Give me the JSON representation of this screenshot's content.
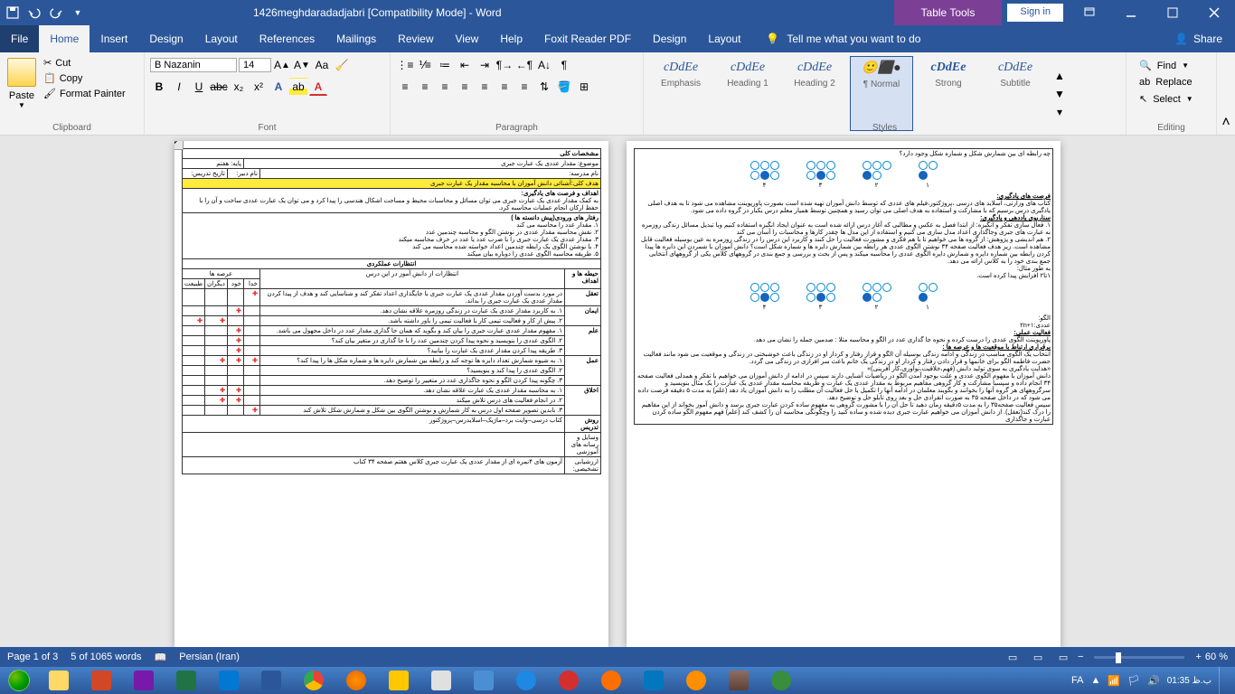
{
  "titlebar": {
    "title": "1426meghdaradadjabri [Compatibility Mode]  -  Word",
    "table_tools": "Table Tools",
    "signin": "Sign in"
  },
  "menu": {
    "file": "File",
    "home": "Home",
    "insert": "Insert",
    "design": "Design",
    "layout": "Layout",
    "references": "References",
    "mailings": "Mailings",
    "review": "Review",
    "view": "View",
    "help": "Help",
    "foxit": "Foxit Reader PDF",
    "tt_design": "Design",
    "tt_layout": "Layout",
    "tellme": "Tell me what you want to do",
    "share": "Share"
  },
  "ribbon": {
    "paste": "Paste",
    "cut": "Cut",
    "copy": "Copy",
    "format_painter": "Format Painter",
    "clipboard": "Clipboard",
    "font_name": "B Nazanin",
    "font_size": "14",
    "font": "Font",
    "paragraph": "Paragraph",
    "styles_label": "Styles",
    "styles": {
      "emphasis": "Emphasis",
      "heading1": "Heading 1",
      "heading2": "Heading 2",
      "normal": "¶ Normal",
      "strong": "Strong",
      "subtitle": "Subtitle",
      "preview": "cDdEe"
    },
    "find": "Find",
    "replace": "Replace",
    "select": "Select",
    "editing": "Editing"
  },
  "statusbar": {
    "page": "Page 1 of 3",
    "words": "5 of 1065 words",
    "language": "Persian (Iran)",
    "zoom": "60 %"
  },
  "taskbar": {
    "lang": "FA",
    "time": "ب.ظ 01:35"
  },
  "doc": {
    "p1": {
      "spec_title": "مشخصات کلی",
      "subject": "موضوع: مقدار عددی یک عبارت جبری",
      "grade": "پایه: هفتم",
      "school": "نام مدرسه:",
      "teacher": "نام دبیر:",
      "date": "تاریخ تدریس:",
      "main_goal": "هدف کلی:آشنائی دانش آموزان با محاسبه مقدار یک عبارت جبری",
      "learn_goals_title": "اهداف و فرصت های یادگیری:",
      "learn_goals": "به کمک مقدار عددی یک  عبارت جبری می توان مسائل و محاسبات محیط و مساحت اشکال هندسی را پیدا کرد و می توان یک  عبارت عددی ساخت و آن را با حفظ ارکان انجام عملیات محاسبه کرد.",
      "input_behav_title": "رفتار های ورودی(پیش دانسته ها )",
      "ib1": "۱.    مقدار عدد را محاسبه می کند",
      "ib2": "۲.   نقش محاسبه مقدار عددی در نوشتن الگو و محاسبه چندمین عدد",
      "ib3": "۳.   مقدار عددی یک عبارت جبری را با ضرب عدد یا عدد در حرف محاسبه میکند",
      "ib4": "۴.   با نوشتن الگوی یک رابطه چندمین اعداد خواسته شده محاسبه می کند",
      "ib5": "۵.   طریقه محاسبه الگوی عددی را دوباره بیان  میکند",
      "expect_title": "انتظارات عملکردی",
      "expect_sub": "انتظارات از دانش آموز در این  درس",
      "col_areas": "عرصه ها",
      "col_rel": "خدا",
      "col_self": "خود",
      "col_others": "دیگران",
      "col_nature": "طبیعت",
      "col_dims": "حیطه ها و اهداف",
      "dim_taaghol": "تعقل",
      "d1_1": "در مورد بدست آوردن مقدار عددی یک عبارت جبری با جایگذاری اعداد تفکر کند و شناسایی کند و هدف از پیدا کردن مقدار عددی یک عبارت جبری را بداند.",
      "dim_iman": "ایمان",
      "d2_1": "۱.   به کاربرد مقدار عددی یک عبارت در زندگی روزمره علاقه نشان دهد.",
      "d2_2": "۲.  پیش از کار و فعالیت تیمی کار یا فعالیت تیمی را باور داشته باشد.",
      "dim_elm": "علم",
      "d3_1": "۱.   مفهوم مقدار عددی عبارت جبری را بیان کند و بگوید که همان جا گذاری مقدار عدد در داخل مجهول می باشد.",
      "d3_2": "۲.   الگوی عددی را بنویسید و نحوه پیدا کردن چندمین عدد را با جا گذاری در متغیر بیان کند؟",
      "d3_3": "۳.   طریقه پیدا کردن مقدار عددی یک عبارت را بیابید؟",
      "dim_amal": "عمل",
      "d4_1": "۱.    به شیوه شمارش تعداد دایره ها توجه کند و رابطه بین شمارش دایره ها و شماره شکل ها را پیدا کند؟",
      "d4_2": "۲.   الگوی عددی را پیدا کند و بنویسید؟",
      "d4_3": "۳.   چگونه پیدا کردن الگو و نحوه جاگذاری عدد در متغییر را توضیح دهد.",
      "dim_akhlagh": "اخلاق",
      "d5_1": "۱.   به محاسبه مقدار عددی یک عبارت علاقه نشان دهد.",
      "d5_2": "۲.  در انجام فعالیت های درس تلاش میکند",
      "d5_3": "۳.   بابدین تصویر صفحه اول درس به کار شمارش و نوشتن الگوی بین شکل و شمارش شکل تلاش کند",
      "method_title": "روش تدریس",
      "method": "کتاب درسی–وایت برد–ماژیک–اسلایدرس–پروژکتور",
      "diag_title": "ارزشیابی تشخیصی:",
      "diag": "آزمون های ۴نمره ای از مقدار عددی یک عبارت جبری کلاس هفتم صفحه ۳۴ کتاب",
      "tools_title": "وسایل و رسانه های آموزشی"
    },
    "p2": {
      "q1": "چه رابطه ای بین شمارش شکل و شماره شکل وجود دارد؟",
      "n1": "۱",
      "n2": "۲",
      "n3": "۳",
      "n4": "۴",
      "learn_opp_title": "فرصت های یادگیری:",
      "learn_opp": "کتاب های وزارتی، اسلاید های درسی ،پروژکتور،فیلم های عددی که توسط دانش آموزان تهیه شده است بصورت پاورپوینت مشاهده می شود تا به هدف اصلی یادگیری درس برسیم که با مشارکت و استفاده به هدف اصلی می توان رسید و همچنین توسط همیار معلم درس یکبار در گروه داده می شود.",
      "scenario_title": "سناریوی یاددهی و یادگیری:",
      "sc1": "۱.   فعال سازی تفکر و انگیزه: از ابتدا فصل به عکس و مطالبی که آغاز درس ارائه شده است به عنوان ایجاد انگیزه استفاده کنیم وبا تبدیل مسائل زندگی روزمره به عبارت های جبری وجاگذاری اعداد مدل سازی می کنیم و استفاده از این مدل ها چقدر کارها و محاسبات را آسان می کند",
      "sc2": "۲.   هم اندیشی و پژوهش: از گروه ها می خواهیم تا با هم فکری و مشورت فعالیت را حل کنند و کاربرد این درس را در زندگی روزمره به عین بوسیله فعالیت قابل مشاهده است. زیر هدف فعالیت صفحه ۳۴ نوشتن الگوی عددی هر رابطه بین شمارش دایره ها و شماره شکل است؟ دانش آموزان با شمردن این دایره ها پیدا کردن رابطه بین شماره دایره و شمارش دایره الگوی عددی را محاسبه میکند و پس از بحث و بررسی و جمع بندی در گروههای کلاس یکی از گروههای انتخابی جمع بندی خود را به کلاس ارائه می دهد.",
      "example": "به طور مثال:",
      "formula": "۱تا۲ افزایش پیدا کرده است.",
      "pattern": "الگو:",
      "pattern_val": "عددی:۱+۲n",
      "activity_title": "فعالیت عملی:",
      "activity": "پاورپوینت الگوی عددی را درست کرده و نحوه جا گذاری عدد در الگو و محاسبه مثلا : صدمین جمله را نشان می دهد.",
      "connection_title": "برقراری ارتباط با موقعیت ها و عرصه ها :",
      "connection": "انتخاب یک الگوی مناسب در زندگی و ادامه زندگی بوسیله آن الگو و قرار رفتار و کردار او در زندگی باعث خوشبختی در زندگی و موقعیت می شود مانند فعالیت حضرت فاطمه الگو برای خانمها و قرار دادن رفتار و کردار او در زندگی یک خانم باعث سر افرازی در زندگی می گردد.",
      "guide": "«هدایت یادگیری به سوی تولید دانش (فهم،خلاقیت،نوآوری،کار آفرینی)»",
      "guide_text": "دانش آموزان با مفهوم الگوی عددی و علت بوجود آمدن الگو در ریاضیات آشنایی دارند سپس در ادامه از دانش آموزان می خواهیم با تفکر و همدلی فعالیت صفحه ۳۴ انجام داده و سپسبا مشارکت و کار گروهی مفاهیم مربوط به مقدار عددی یک عبارت و طریقه محاسبه مقدار عددی یک عبارت را یک مثال بنویسید و سرگروههای هر گروه آنها را بخوانند و بگویند معلمان در ادامه آنها را تکمیل یا حل فعالیت آن مطلب را به دانش آموزان یاد دهد (علم) به مدت ۵ دقیقه فرصت داده می شود که در داخل صفحه ۳۵ به صورت انفرادی حل و بعد روی تابلو حل و توضیح دهد.",
      "final": "سپس فعالیت صفحه۳۵ را به مدت ۵دقیقه زمان دهید تا حل آن را با مشورت گروهی به مفهوم ساده کردن عبارت جبری برسد و دانش آموز بخواند از این مفاهیم را درک کند(تعقل). از دانش آموزان می خواهیم عبارت جبری دیده شده و ساده کنید را وچگونگی محاسبه آن را کشف کند (علم) فهم مفهوم الگو ساده کردن عبارت و جاگذاری"
    }
  }
}
